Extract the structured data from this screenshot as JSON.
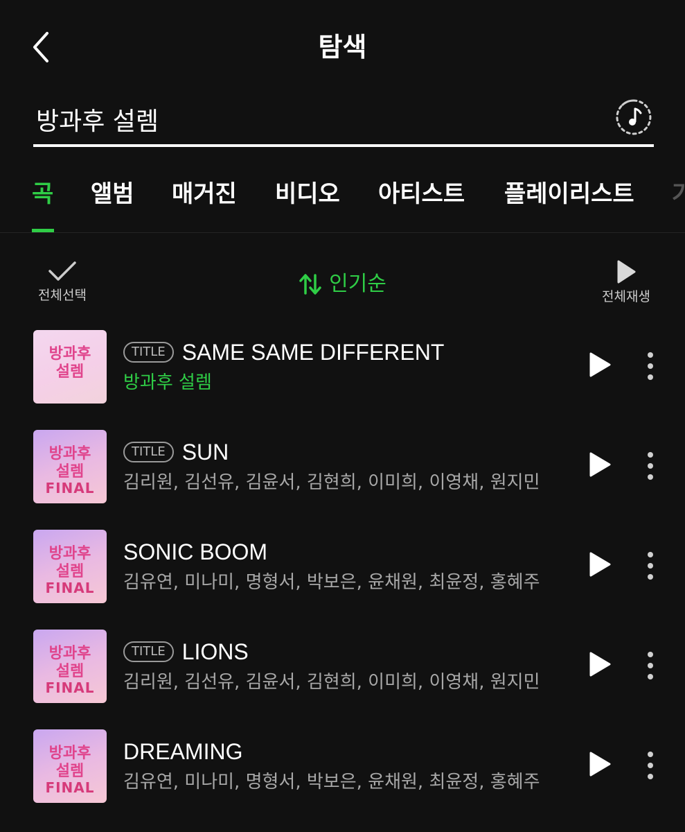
{
  "header": {
    "title": "탐색"
  },
  "search": {
    "value": "방과후 설렘"
  },
  "tabs": [
    {
      "label": "곡"
    },
    {
      "label": "앨범"
    },
    {
      "label": "매거진"
    },
    {
      "label": "비디오"
    },
    {
      "label": "아티스트"
    },
    {
      "label": "플레이리스트"
    },
    {
      "label": "가"
    }
  ],
  "controls": {
    "select_all": "전체선택",
    "sort": "인기순",
    "play_all": "전체재생"
  },
  "album_art": {
    "line1": "방과후",
    "line2": "설렘",
    "final": "FINAL"
  },
  "songs": [
    {
      "badge": "TITLE",
      "title": "SAME SAME DIFFERENT",
      "artist": "방과후 설렘"
    },
    {
      "badge": "TITLE",
      "title": "SUN",
      "artist": "김리원, 김선유, 김윤서, 김현희, 이미희, 이영채, 원지민"
    },
    {
      "badge": "",
      "title": "SONIC BOOM",
      "artist": "김유연, 미나미, 명형서, 박보은, 윤채원, 최윤정, 홍혜주"
    },
    {
      "badge": "TITLE",
      "title": "LIONS",
      "artist": "김리원, 김선유, 김윤서, 김현희, 이미희, 이영채, 원지민"
    },
    {
      "badge": "",
      "title": "DREAMING",
      "artist": "김유연, 미나미, 명형서, 박보은, 윤채원, 최윤정, 홍혜주"
    }
  ],
  "colors": {
    "accent": "#2fcd46",
    "background": "#111111"
  }
}
